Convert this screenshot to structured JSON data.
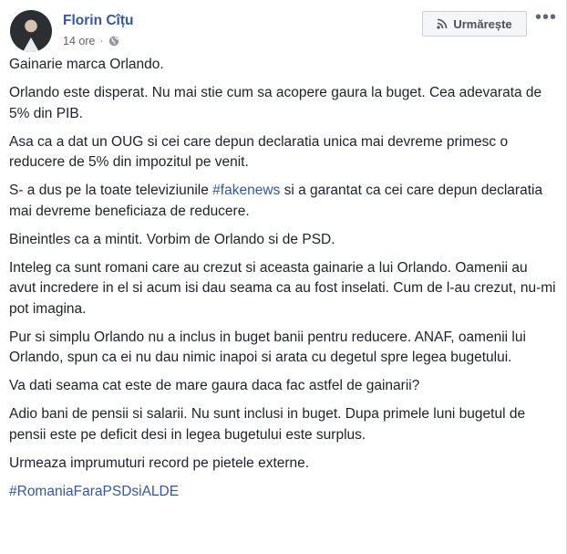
{
  "author": {
    "name": "Florin Cîțu",
    "time": "14 ore",
    "privacy_icon": "globe-icon"
  },
  "follow_button": {
    "label": "Urmărește",
    "icon": "rss-icon"
  },
  "more_button": {
    "label": "•••"
  },
  "post": {
    "p1": "Gainarie marca Orlando.",
    "p2": "Orlando este disperat. Nu mai stie cum sa acopere gaura la buget. Cea adevarata de 5% din PIB.",
    "p3": "Asa ca a dat un OUG si cei care depun declaratia unica mai devreme primesc o reducere de 5% din impozitul pe venit.",
    "p4_before": "S- a dus pe la toate televiziunile ",
    "p4_hashtag": "#fakenews",
    "p4_after": " si a garantat ca cei care depun declaratia mai devreme beneficiaza de reducere.",
    "p5": "Bineintles ca a mintit. Vorbim de Orlando si de PSD.",
    "p6": "Inteleg ca sunt romani care au crezut si aceasta gainarie a lui Orlando. Oamenii au avut incredere in el si acum isi dau seama ca au fost inselati. Cum de l-au crezut, nu-mi pot imagina.",
    "p7": "Pur si simplu Orlando nu a inclus in buget banii pentru reducere. ANAF, oamenii lui Orlando, spun ca ei nu dau nimic inapoi si arata cu degetul spre legea bugetului.",
    "p8": "Va dati seama cat este de mare gaura daca fac astfel de gainarii?",
    "p9": "Adio bani de pensii si salarii. Nu sunt inclusi in buget. Dupa primele luni bugetul de pensii este pe deficit desi in legea bugetului este surplus.",
    "p10": "Urmeaza imprumuturi record pe pietele externe.",
    "p11_hashtag": "#RomaniaFaraPSDsiALDE"
  },
  "colors": {
    "link": "#385898",
    "text": "#1d2129",
    "meta": "#616770"
  }
}
